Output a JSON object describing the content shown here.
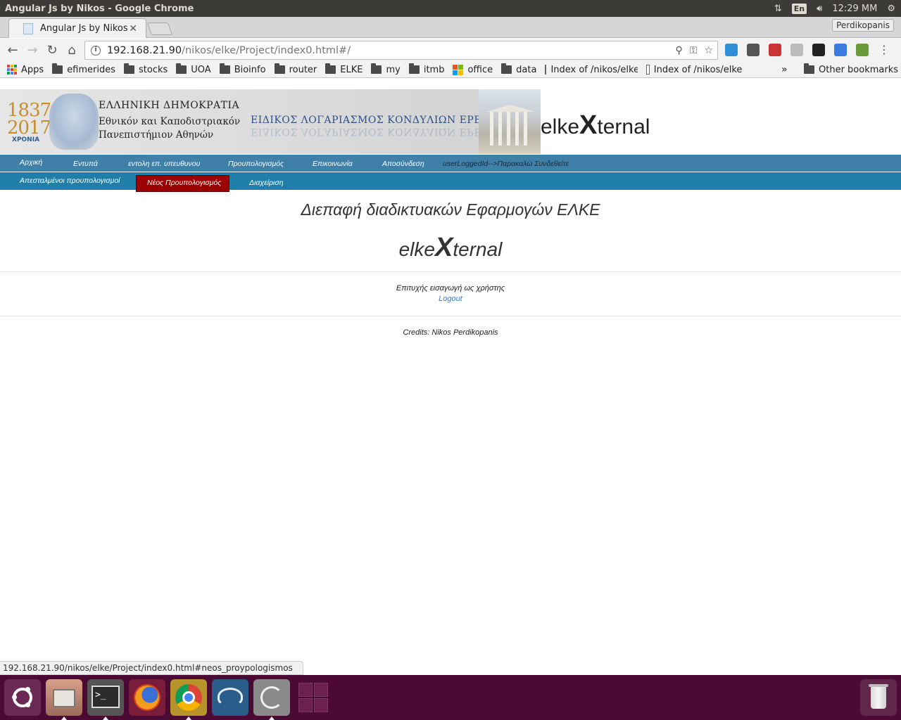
{
  "os": {
    "window_title": "Angular Js by Nikos - Google Chrome",
    "lang": "En",
    "clock": "12:29 ΜΜ"
  },
  "browser": {
    "tab_title": "Angular Js by Nikos",
    "profile": "Perdikopanis",
    "url_host": "192.168.21.90",
    "url_path": "/nikos/elke/Project/index0.html#/",
    "status_url": "192.168.21.90/nikos/elke/Project/index0.html#neos_proypologismos"
  },
  "bookmarks": {
    "items": [
      {
        "label": "Apps",
        "type": "apps"
      },
      {
        "label": "efimerides",
        "type": "folder"
      },
      {
        "label": "stocks",
        "type": "folder"
      },
      {
        "label": "UOA",
        "type": "folder"
      },
      {
        "label": "Bioinfo",
        "type": "folder"
      },
      {
        "label": "router",
        "type": "folder"
      },
      {
        "label": "ELKE",
        "type": "folder"
      },
      {
        "label": "my",
        "type": "folder"
      },
      {
        "label": "itmb",
        "type": "folder"
      },
      {
        "label": "office",
        "type": "ms"
      },
      {
        "label": "data",
        "type": "folder"
      },
      {
        "label": "Index of /nikos/elke",
        "type": "page"
      },
      {
        "label": "Index of /nikos/elke",
        "type": "page"
      }
    ],
    "more": "»",
    "other": "Other bookmarks"
  },
  "banner": {
    "year_top": "1837",
    "year_bottom": "2017",
    "years_word": "ΧΡΟΝΙΑ",
    "line1": "ΕΛΛΗΝΙΚΗ ΔΗΜΟΚΡΑΤΙΑ",
    "line2": "Εθνικόν και Καποδιστριακόν",
    "line3": "Πανεπιστήμιον Αθηνών",
    "elke": "ΕΙΔΙΚΟΣ ΛΟΓΑΡΙΑΣΜΟΣ ΚΟΝΔΥΛΙΩΝ ΕΡΕΥΝΑΣ",
    "brand_pre": "elke",
    "brand_x": "X",
    "brand_post": "ternal"
  },
  "nav1": {
    "home": "Αρχική",
    "forms": "Εντυπά",
    "order": "εντολη επ. υπευθυνου",
    "budget": "Προυπολογισμός",
    "contact": "Επικοινωνία",
    "logout": "Αποσύνδεση",
    "status": "userLoggedId-->Παρακαλώ Συνδεθείτε"
  },
  "nav2": {
    "sent": "Απεσταλμένοι προυπολογισμοί",
    "new": "Νέος Προυπολογισμός",
    "admin": "Διαχείριση"
  },
  "main": {
    "title": "Διεπαφή διαδικτυακών Εφαρμογών ΕΛΚΕ",
    "brand_pre": "elke",
    "brand_x": "X",
    "brand_post": "ternal",
    "login_ok": "Επιτυχής εισαγωγή ως χρήστης",
    "logout": "Logout",
    "credits": "Credits: Nikos Perdikopanis"
  },
  "colors": {
    "nav_primary": "#3f7fa8",
    "nav_secondary": "#1f7fa8",
    "active_tab": "#9b0000",
    "launcher": "#4a0a33"
  },
  "launcher": {
    "items": [
      "dash-icon",
      "files-icon",
      "terminal-icon",
      "firefox-icon",
      "chrome-icon",
      "mysql-workbench-icon",
      "remmina-icon",
      "workspace-switcher-icon",
      "trash-icon"
    ]
  }
}
